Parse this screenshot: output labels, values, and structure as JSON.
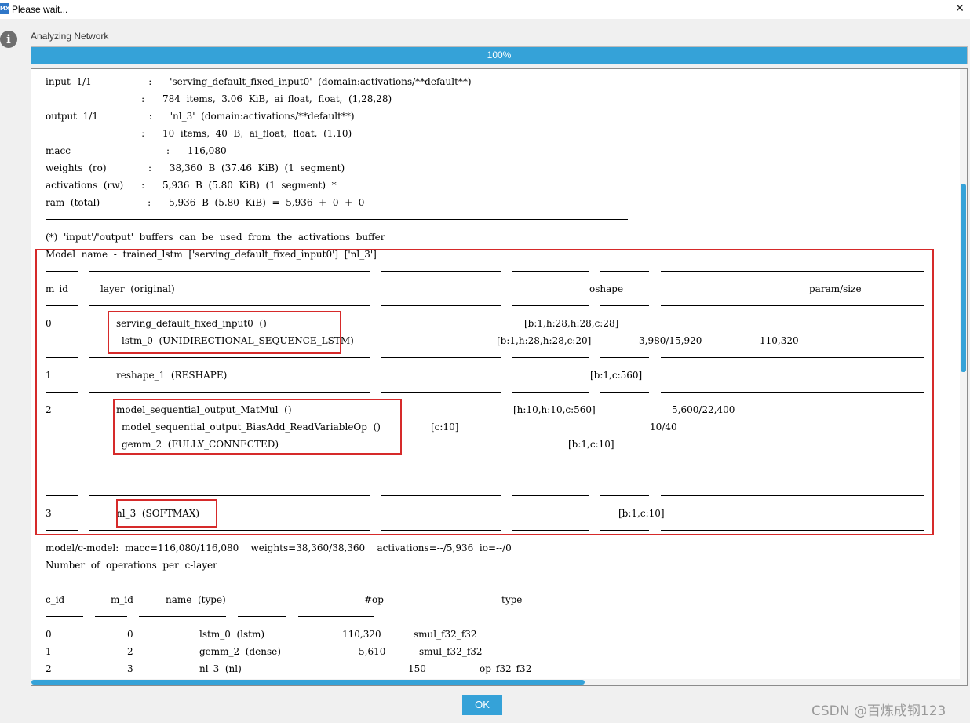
{
  "window": {
    "title": "Please wait...",
    "icon": "app-icon",
    "close_glyph": "✕",
    "icon_text": "MX"
  },
  "status": {
    "label": "Analyzing Network",
    "info_glyph": "i"
  },
  "progress": {
    "percent": 100,
    "text": "100%"
  },
  "summary": {
    "lines": [
      "input  1/1                   :      'serving_default_fixed_input0'  (domain:activations/**default**)",
      "                                :      784  items,  3.06  KiB,  ai_float,  float,  (1,28,28)",
      "output  1/1                 :      'nl_3'  (domain:activations/**default**)",
      "                                :      10  items,  40  B,  ai_float,  float,  (1,10)",
      "macc                                :      116,080",
      "weights  (ro)              :      38,360  B  (37.46  KiB)  (1  segment)",
      "activations  (rw)      :      5,936  B  (5.80  KiB)  (1  segment)  *",
      "ram  (total)                :      5,936  B  (5.80  KiB)  =  5,936  +  0  +  0"
    ],
    "note": "(*)  'input'/'output'  buffers  can  be  used  from  the  activations  buffer"
  },
  "model": {
    "name_line": "Model  name  -  trained_lstm  ['serving_default_fixed_input0']  ['nl_3']",
    "headers": {
      "m_id": "m_id",
      "layer": "layer  (original)",
      "oshape": "oshape",
      "param": "param/size"
    },
    "rows": [
      {
        "id": "0",
        "layer1": "serving_default_fixed_input0  ()",
        "oshape1": "[b:1,h:28,h:28,c:28]",
        "layer2": "lstm_0  (UNIDIRECTIONAL_SEQUENCE_LSTM)",
        "oshape2": "[b:1,h:28,h:28,c:20]",
        "param2": "3,980/15,920",
        "extra2": "110,320"
      },
      {
        "id": "1",
        "layer1": "reshape_1  (RESHAPE)",
        "oshape1": "[b:1,c:560]"
      },
      {
        "id": "2",
        "layer1": "model_sequential_output_MatMul  ()",
        "oshape1": "[h:10,h:10,c:560]",
        "param1": "5,600/22,400",
        "layer2": "model_sequential_output_BiasAdd_ReadVariableOp  ()",
        "oshape2": "[c:10]",
        "param2": "10/40",
        "layer3": "gemm_2  (FULLY_CONNECTED)",
        "oshape3": "[b:1,c:10]"
      },
      {
        "id": "3",
        "layer1": "nl_3  (SOFTMAX)",
        "oshape1": "[b:1,c:10]"
      }
    ]
  },
  "cmodel": {
    "summary": "model/c-model:  macc=116,080/116,080    weights=38,360/38,360    activations=--/5,936  io=--/0",
    "title": "Number  of  operations  per  c-layer",
    "headers": {
      "c_id": "c_id",
      "m_id": "m_id",
      "name": "name  (type)",
      "op": "#op",
      "type": "type"
    },
    "rows": [
      {
        "c_id": "0",
        "m_id": "0",
        "name": "lstm_0  (lstm)",
        "op": "110,320",
        "type": "smul_f32_f32"
      },
      {
        "c_id": "1",
        "m_id": "2",
        "name": "gemm_2  (dense)",
        "op": "5,610",
        "type": "smul_f32_f32"
      },
      {
        "c_id": "2",
        "m_id": "3",
        "name": "nl_3  (nl)",
        "op": "150",
        "type": "op_f32_f32"
      }
    ]
  },
  "buttons": {
    "ok": "OK"
  },
  "watermark": "CSDN @百炼成钢123",
  "colors": {
    "accent": "#35a2d8",
    "highlight_box": "#d62a2a"
  }
}
